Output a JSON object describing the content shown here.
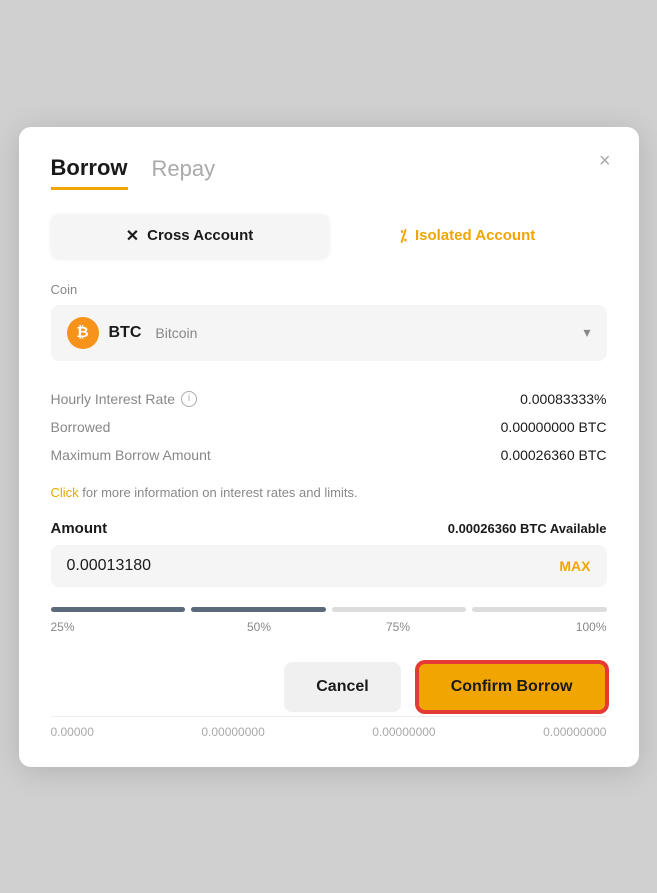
{
  "modal": {
    "tab_borrow": "Borrow",
    "tab_repay": "Repay",
    "close_label": "×"
  },
  "account": {
    "cross_label": "Cross Account",
    "cross_icon": "✕",
    "isolated_label": "Isolated Account",
    "isolated_icon": "%"
  },
  "coin": {
    "label": "Coin",
    "symbol": "BTC",
    "full_name": "Bitcoin",
    "icon_text": "₿"
  },
  "info": {
    "hourly_interest_rate_label": "Hourly Interest Rate",
    "hourly_interest_rate_value": "0.00083333%",
    "borrowed_label": "Borrowed",
    "borrowed_value": "0.00000000 BTC",
    "max_borrow_label": "Maximum Borrow Amount",
    "max_borrow_value": "0.00026360 BTC",
    "click_text": "Click",
    "click_suffix": " for more information on interest rates and limits."
  },
  "amount": {
    "label": "Amount",
    "available_amount": "0.00026360",
    "available_label": "BTC Available",
    "input_value": "0.00013180",
    "max_label": "MAX"
  },
  "slider": {
    "segments": [
      {
        "filled": true
      },
      {
        "filled": true
      },
      {
        "filled": false
      },
      {
        "filled": false
      }
    ],
    "labels": [
      "25%",
      "50%",
      "75%",
      "100%"
    ]
  },
  "buttons": {
    "cancel_label": "Cancel",
    "confirm_label": "Confirm Borrow"
  },
  "bottom_data": [
    "0.00000",
    "0.00000000",
    "0.00000000",
    "0.00000000"
  ]
}
